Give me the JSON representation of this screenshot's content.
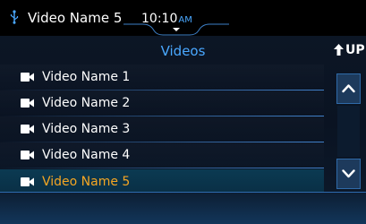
{
  "status_bar": {
    "now_playing": "Video Name 5",
    "time": "10:10",
    "ampm": "AM",
    "usb_icon": "usb-icon"
  },
  "header": {
    "title": "Videos",
    "up_label": "UP",
    "up_icon": "up-arrow-icon"
  },
  "list": {
    "items": [
      {
        "label": "Video Name 1",
        "icon": "video-camera-icon"
      },
      {
        "label": "Video Name 2",
        "icon": "video-camera-icon"
      },
      {
        "label": "Video Name 3",
        "icon": "video-camera-icon"
      },
      {
        "label": "Video Name 4",
        "icon": "video-camera-icon"
      },
      {
        "label": "Video Name 5",
        "icon": "video-camera-icon",
        "selected": true
      }
    ]
  },
  "scrollbar": {
    "up_icon": "chevron-up-icon",
    "down_icon": "chevron-down-icon"
  },
  "colors": {
    "accent_blue": "#4aa8ff",
    "selected_text": "#f5a623",
    "background": "#0a1220"
  }
}
